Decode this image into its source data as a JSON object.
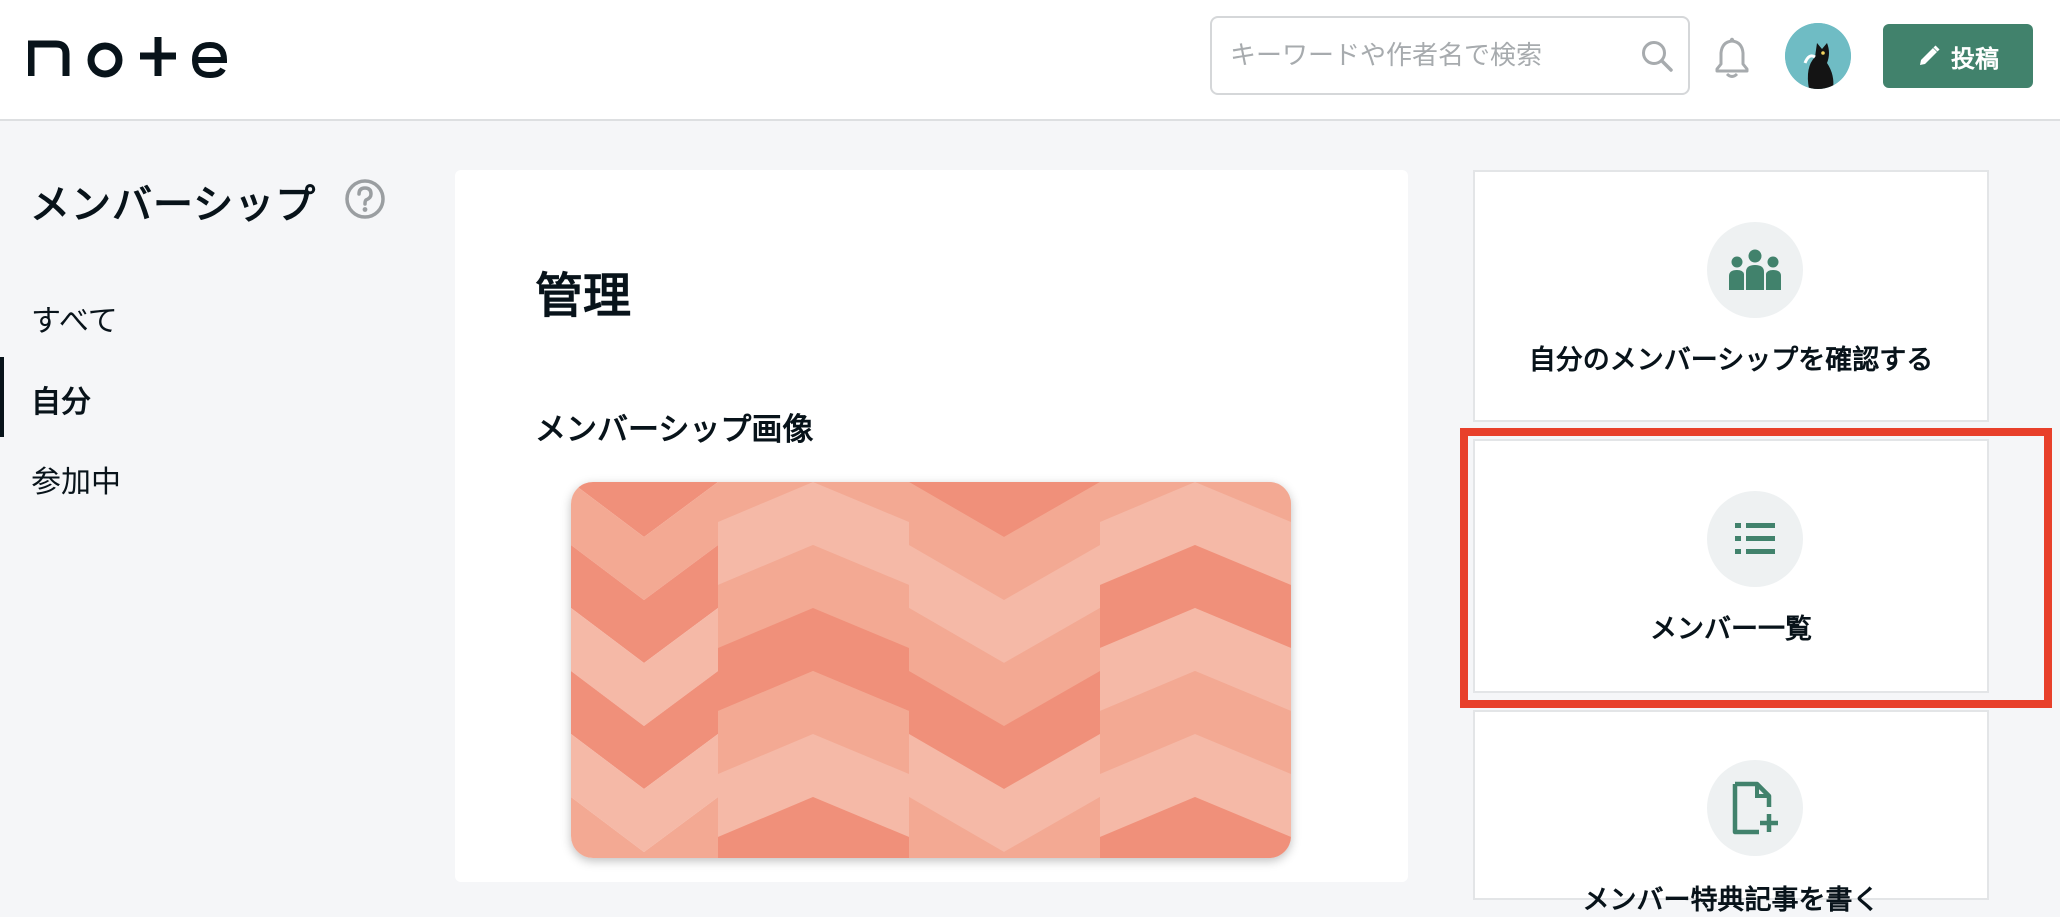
{
  "header": {
    "logo_text": "note",
    "search_placeholder": "キーワードや作者名で検索",
    "post_button_label": "投稿"
  },
  "sidebar": {
    "title": "メンバーシップ",
    "items": [
      {
        "label": "すべて",
        "active": false
      },
      {
        "label": "自分",
        "active": true
      },
      {
        "label": "参加中",
        "active": false
      }
    ]
  },
  "main": {
    "title": "管理",
    "image_section_label": "メンバーシップ画像"
  },
  "actions": [
    {
      "label": "自分のメンバーシップを確認する",
      "icon": "people-group-icon"
    },
    {
      "label": "メンバー一覧",
      "icon": "list-icon"
    },
    {
      "label": "メンバー特典記事を書く",
      "icon": "file-add-icon"
    }
  ],
  "colors": {
    "accent_green": "#41826c",
    "highlight_red": "#e8402b",
    "banner_colors": [
      "#f0907a",
      "#f3a993",
      "#f5b9a7"
    ]
  }
}
